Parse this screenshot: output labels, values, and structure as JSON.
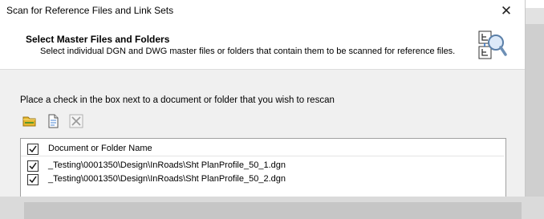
{
  "window": {
    "title": "Scan for Reference Files and Link Sets",
    "close_glyph": "✕"
  },
  "header": {
    "title": "Select Master Files and Folders",
    "subtitle": "Select individual DGN and DWG master files or folders that contain them to be scanned for reference files.",
    "icon": "reference-scan-icon"
  },
  "instruction": "Place a check in the box next to a document or folder that you wish to rescan",
  "toolbar": {
    "buttons": [
      {
        "icon": "add-folder-icon",
        "enabled": true
      },
      {
        "icon": "add-document-icon",
        "enabled": true
      },
      {
        "icon": "remove-icon",
        "enabled": false
      }
    ]
  },
  "list": {
    "header": {
      "label": "Document or Folder Name",
      "checked": true
    },
    "rows": [
      {
        "label": "_Testing\\0001350\\Design\\InRoads\\Sht PlanProfile_50_1.dgn",
        "checked": true
      },
      {
        "label": "_Testing\\0001350\\Design\\InRoads\\Sht PlanProfile_50_2.dgn",
        "checked": true
      }
    ]
  },
  "colors": {
    "folder": "#e8b82c",
    "accent_blue": "#2a6fc9",
    "disabled": "#9a9a9a"
  }
}
